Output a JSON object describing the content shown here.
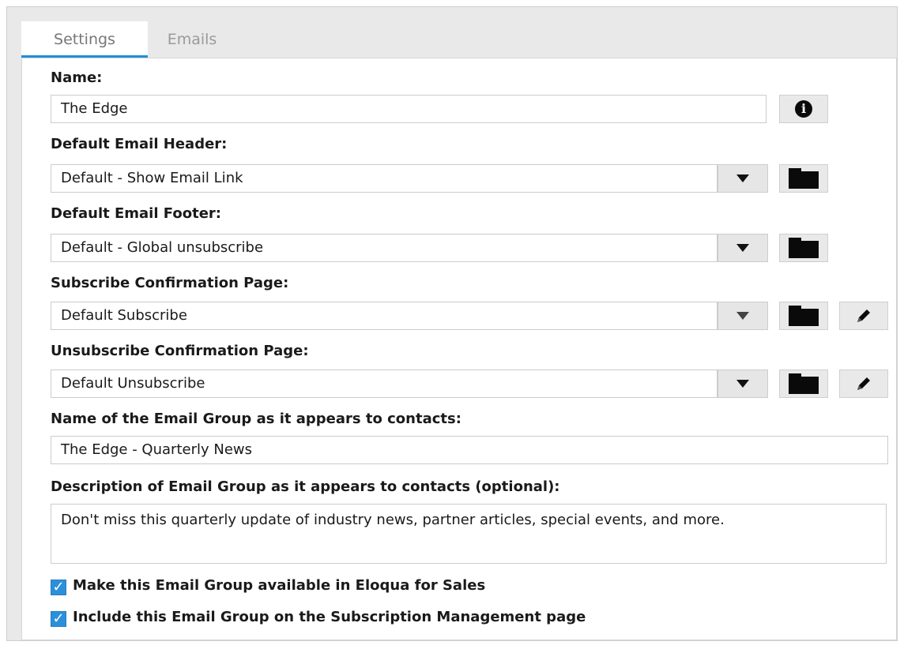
{
  "tabs": [
    {
      "label": "Settings"
    },
    {
      "label": "Emails"
    }
  ],
  "form": {
    "name_label": "Name:",
    "name_value": "The Edge",
    "header_label": "Default Email Header:",
    "header_value": "Default - Show Email Link",
    "footer_label": "Default Email Footer:",
    "footer_value": "Default - Global unsubscribe",
    "subscribe_label": "Subscribe Confirmation Page:",
    "subscribe_value": "Default Subscribe",
    "unsubscribe_label": "Unsubscribe Confirmation Page:",
    "unsubscribe_value": "Default Unsubscribe",
    "group_name_label": "Name of the Email Group as it appears to contacts:",
    "group_name_value": "The Edge - Quarterly News",
    "description_label": "Description of Email Group as it appears to contacts (optional):",
    "description_value": "Don't miss this quarterly update of industry news, partner articles, special events, and more.",
    "checkbox_sales_label": "Make this Email Group available in Eloqua for Sales",
    "checkbox_subscription_label": "Include this Email Group on the Subscription Management page",
    "check_glyph": "✓"
  },
  "icons": {
    "info": "info-icon",
    "dropdown": "chevron-down-icon",
    "folder": "folder-icon",
    "edit": "pencil-icon"
  },
  "colors": {
    "accent": "#1e90d8",
    "checkbox": "#2b90d9"
  }
}
